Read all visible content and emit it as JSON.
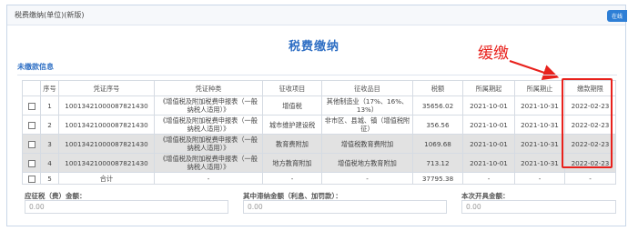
{
  "window": {
    "title": "税费缴纳(单位)(新版)",
    "help_label": "在线"
  },
  "page_title": "税费缴纳",
  "annotation": {
    "text": "缓缴",
    "color": "#e8211c"
  },
  "section": {
    "label": "未缴款信息"
  },
  "table": {
    "headers": [
      "",
      "序号",
      "凭证序号",
      "凭证种类",
      "征收项目",
      "征收品目",
      "税额",
      "所属期起",
      "所属期止",
      "缴款期限"
    ],
    "rows": [
      {
        "no": "1",
        "voucher_no": "10013421000087821430",
        "voucher_type": "《增值税及附加税费申报表（一般纳税人适用）》",
        "item": "增值税",
        "subitem": "其他制造业（17%、16%、13%）",
        "amount": "35656.02",
        "start": "2021-10-01",
        "end": "2021-10-31",
        "deadline": "2022-02-23"
      },
      {
        "no": "2",
        "voucher_no": "10013421000087821430",
        "voucher_type": "《增值税及附加税费申报表（一般纳税人适用）》",
        "item": "城市维护建设税",
        "subitem": "非市区、县城、镇（增值税附征）",
        "amount": "356.56",
        "start": "2021-10-01",
        "end": "2021-10-31",
        "deadline": "2022-02-23"
      },
      {
        "no": "3",
        "voucher_no": "10013421000087821430",
        "voucher_type": "《增值税及附加税费申报表（一般纳税人适用）》",
        "item": "教育费附加",
        "subitem": "增值税教育费附加",
        "amount": "1069.68",
        "start": "2021-10-01",
        "end": "2021-10-31",
        "deadline": "2022-02-23"
      },
      {
        "no": "4",
        "voucher_no": "10013421000087821430",
        "voucher_type": "《增值税及附加税费申报表（一般纳税人适用）》",
        "item": "地方教育附加",
        "subitem": "增值税地方教育附加",
        "amount": "713.12",
        "start": "2021-10-01",
        "end": "2021-10-31",
        "deadline": "2022-02-23"
      }
    ],
    "total": {
      "no": "5",
      "label": "合计",
      "voucher_type": "-",
      "item": "-",
      "subitem": "-",
      "amount": "37795.38",
      "start": "-",
      "end": "-",
      "deadline": "-"
    }
  },
  "bottom": {
    "field1": {
      "label": "应征税（费）金额：",
      "value": "0.00"
    },
    "field2": {
      "label": "其中滞纳金额（利息、加罚款）：",
      "value": "0.00"
    },
    "field3": {
      "label": "本次开具金额：",
      "value": "0.00"
    }
  }
}
